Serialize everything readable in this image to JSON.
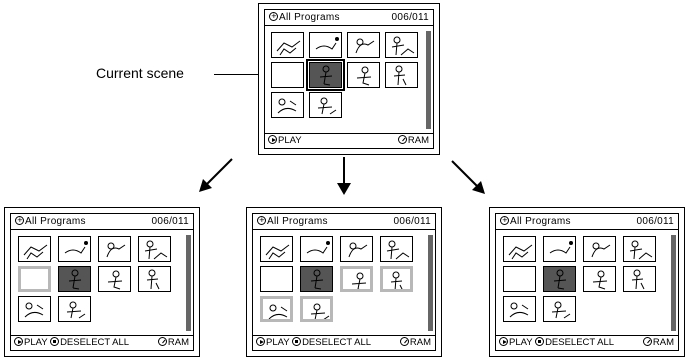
{
  "callout": {
    "label": "Current scene"
  },
  "top_screen": {
    "title": "All Programs",
    "counter": "006/011",
    "footer_left": "PLAY",
    "footer_right": "RAM"
  },
  "left_screen": {
    "title": "All Programs",
    "counter": "006/011",
    "footer_left": "PLAY",
    "footer_mid": "DESELECT ALL",
    "footer_right": "RAM"
  },
  "middle_screen": {
    "title": "All Programs",
    "counter": "006/011",
    "footer_left": "PLAY",
    "footer_mid": "DESELECT ALL",
    "footer_right": "RAM"
  },
  "right_screen": {
    "title": "All Programs",
    "counter": "006/011",
    "footer_left": "PLAY",
    "footer_mid": "DESELECT ALL",
    "footer_right": "RAM"
  },
  "icons": [
    "joystick-icon",
    "play-icon",
    "stop-icon",
    "ram-disc-icon",
    "arrow-down-left",
    "arrow-down",
    "arrow-down-right"
  ]
}
